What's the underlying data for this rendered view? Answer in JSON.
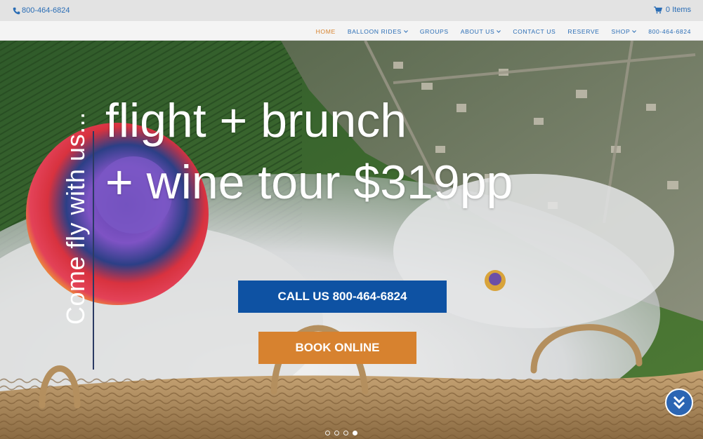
{
  "topbar": {
    "phone": "800-464-6824",
    "cart_label": "0 Items"
  },
  "nav": {
    "items": [
      {
        "label": "HOME",
        "active": true,
        "dropdown": false
      },
      {
        "label": "BALLOON RIDES",
        "active": false,
        "dropdown": true
      },
      {
        "label": "GROUPS",
        "active": false,
        "dropdown": false
      },
      {
        "label": "ABOUT US",
        "active": false,
        "dropdown": true
      },
      {
        "label": "CONTACT US",
        "active": false,
        "dropdown": false
      },
      {
        "label": "RESERVE",
        "active": false,
        "dropdown": false
      },
      {
        "label": "SHOP",
        "active": false,
        "dropdown": true
      },
      {
        "label": "800-464-6824",
        "active": false,
        "dropdown": false
      }
    ]
  },
  "hero": {
    "vertical_text": "Come fly with us...",
    "headline_line1": "flight + brunch",
    "headline_line2": "+ wine tour $319pp",
    "call_button": "CALL US 800-464-6824",
    "book_button": "BOOK ONLINE",
    "slides": 4,
    "active_slide": 4
  },
  "colors": {
    "primary": "#0e52a3",
    "accent": "#d7822f",
    "link": "#2a6db5",
    "active_nav": "#d7832e"
  },
  "icons": [
    "phone-icon",
    "cart-icon",
    "chevron-down-icon",
    "scroll-down-icon"
  ]
}
